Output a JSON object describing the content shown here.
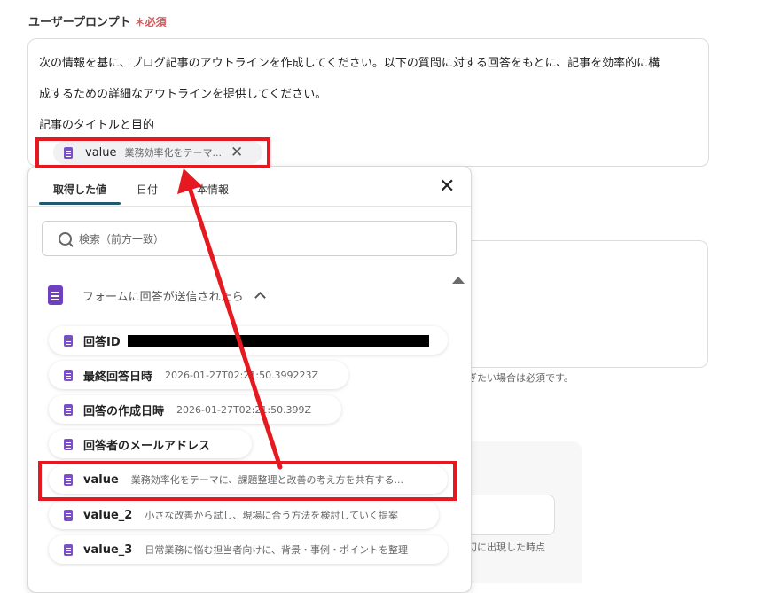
{
  "field": {
    "label": "ユーザープロンプト",
    "required_mark": "＊必須"
  },
  "prompt": {
    "lines": [
      "次の情報を基に、ブログ記事のアウトラインを作成してください。以下の質問に対する回答をもとに、記事を効率的に構",
      "成するための詳細なアウトラインを提供してください。",
      "記事のタイトルと目的"
    ],
    "chip": {
      "icon": "google-forms-doc-icon",
      "key": "value",
      "value": "業務効率化をテーマ...",
      "close_icon": "close-icon"
    }
  },
  "background": {
    "hint1": "ぎたい場合は必須です。",
    "hint2": "初に出現した時点"
  },
  "dropdown": {
    "tabs": [
      "取得した値",
      "日付",
      "本情報"
    ],
    "active_tab": 0,
    "search_placeholder": "検索（前方一致）",
    "group": {
      "title": "フォームに回答が送信されたら",
      "expanded": true
    },
    "items": [
      {
        "key": "回答ID",
        "value": "",
        "redacted": true
      },
      {
        "key": "最終回答日時",
        "value": "2026-01-27T02:21:50.399223Z"
      },
      {
        "key": "回答の作成日時",
        "value": "2026-01-27T02:21:50.399Z"
      },
      {
        "key": "回答者のメールアドレス",
        "value": ""
      },
      {
        "key": "value",
        "value": "業務効率化をテーマに、課題整理と改善の考え方を共有する..."
      },
      {
        "key": "value_2",
        "value": "小さな改善から試し、現場に合う方法を検討していく提案"
      },
      {
        "key": "value_3",
        "value": "日常業務に悩む担当者向けに、背景・事例・ポイントを整理"
      }
    ]
  },
  "annotation": {
    "color": "#e5191f"
  }
}
